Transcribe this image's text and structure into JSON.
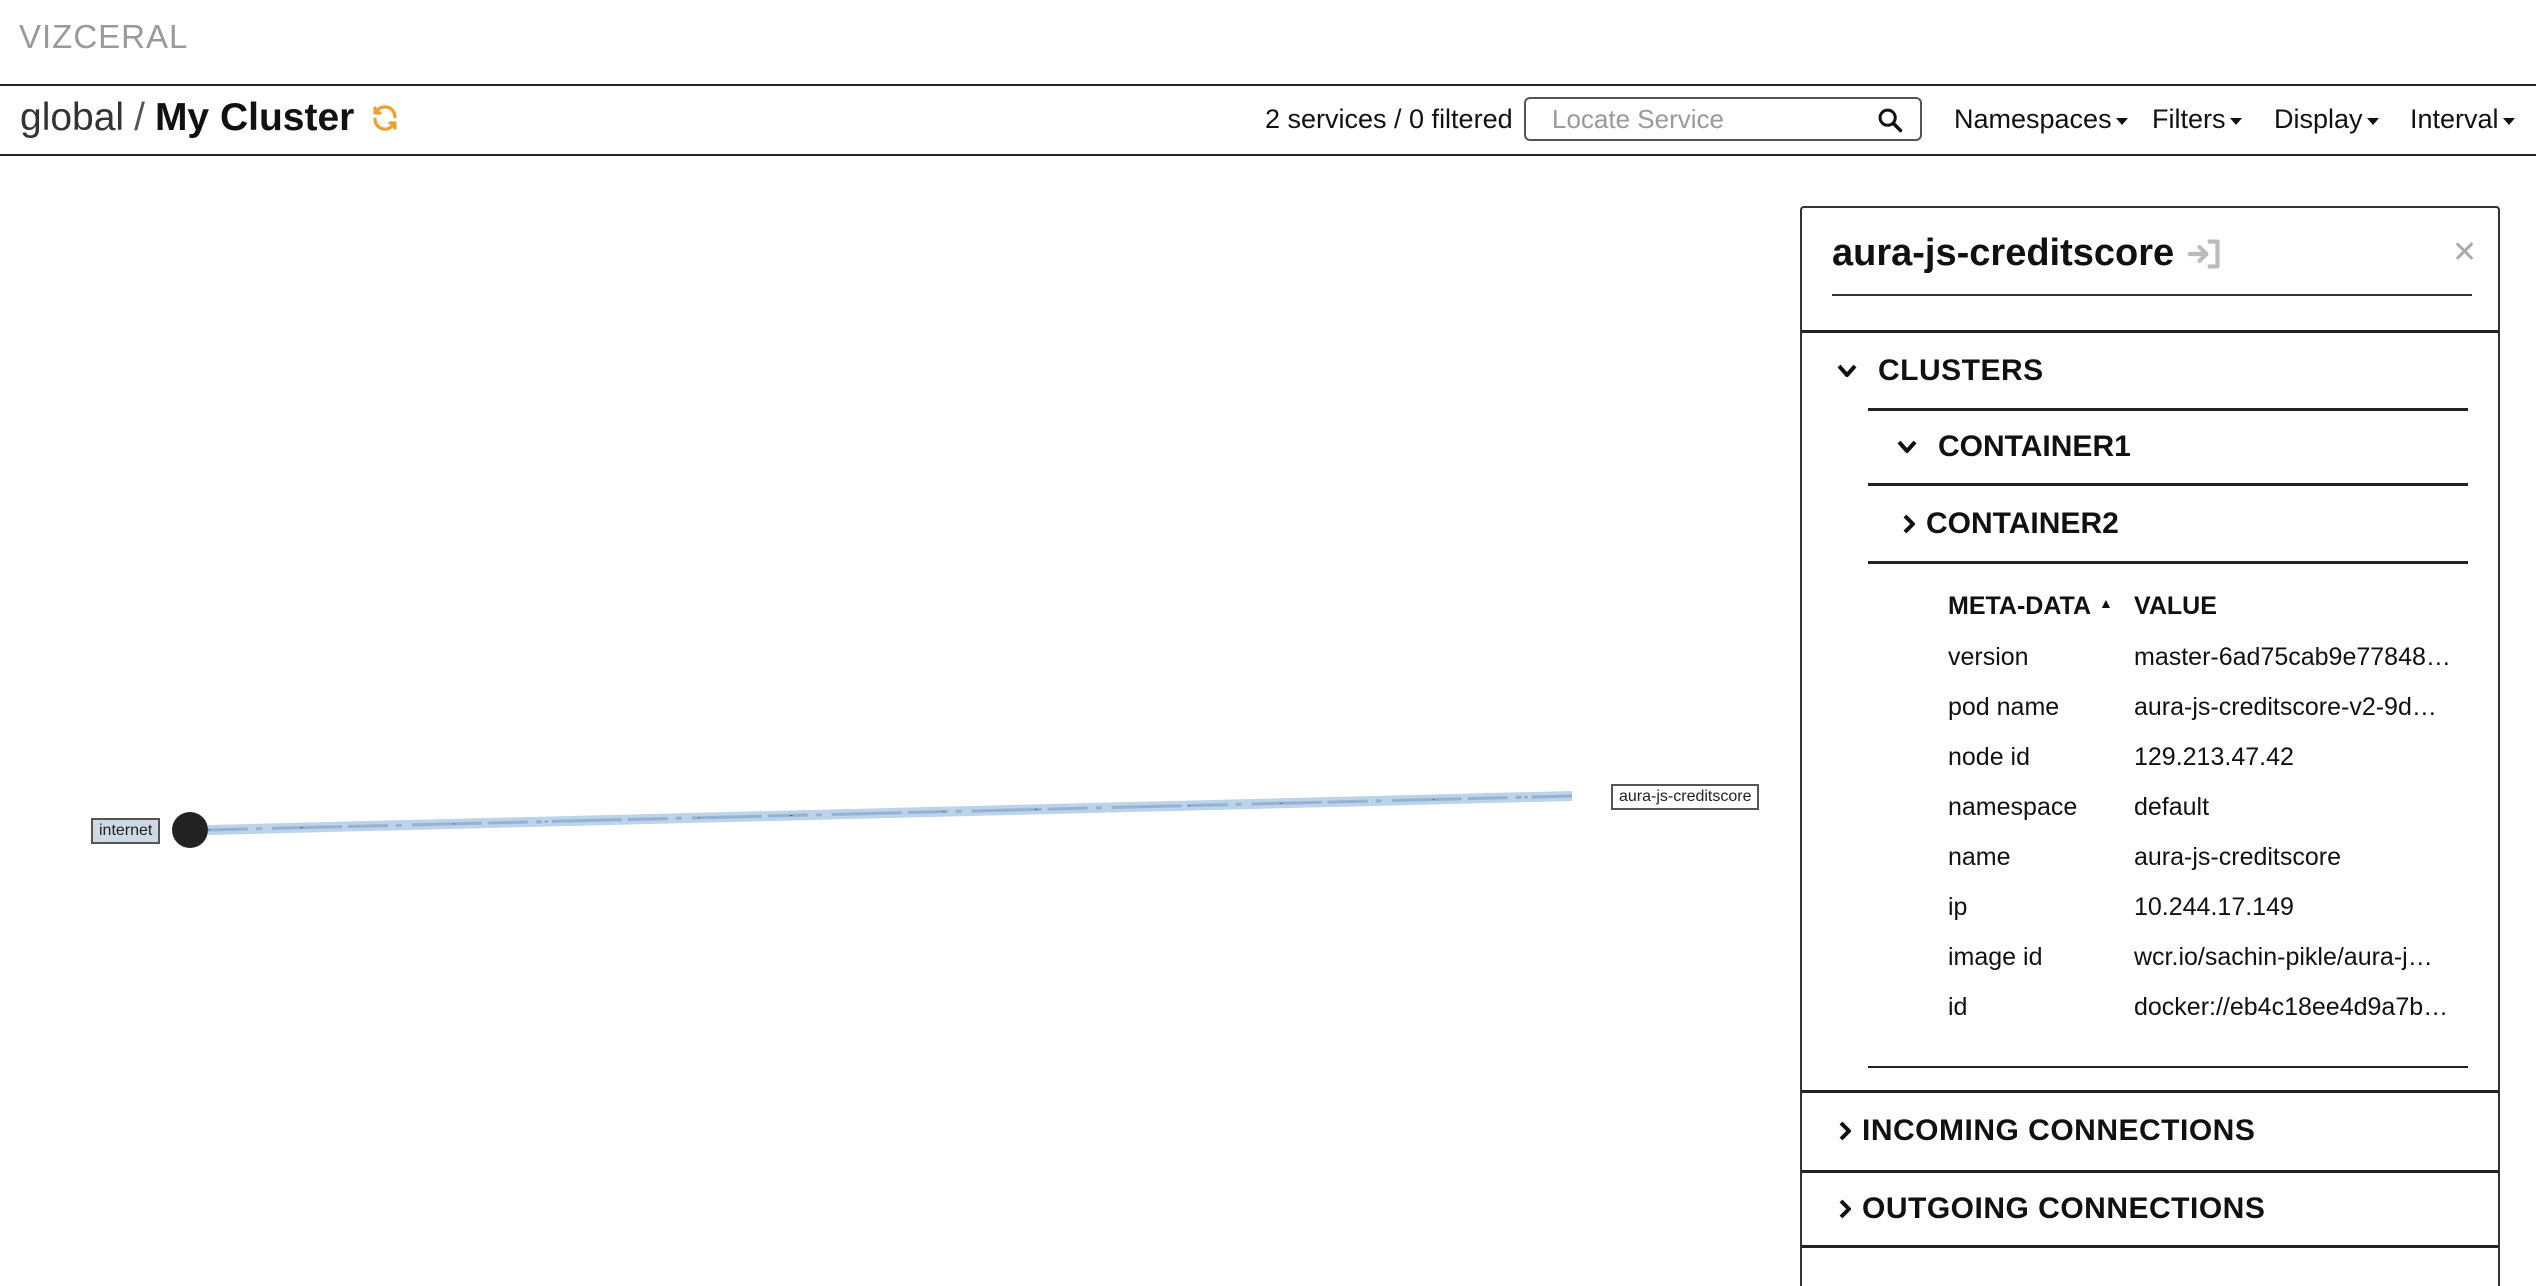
{
  "brand": "VIZCERAL",
  "breadcrumb": {
    "root": "global",
    "separator": "/",
    "current": "My Cluster"
  },
  "toolbar": {
    "service_count": "2 services / 0 filtered",
    "search_placeholder": "Locate Service",
    "menus": [
      "Namespaces",
      "Filters",
      "Display",
      "Interval"
    ]
  },
  "graph": {
    "nodes": [
      {
        "label": "internet"
      },
      {
        "label": "aura-js-creditscore"
      }
    ]
  },
  "panel": {
    "title": "aura-js-creditscore",
    "sections": {
      "clusters": "CLUSTERS",
      "container1": "CONTAINER1",
      "container2": "CONTAINER2",
      "incoming": "INCOMING CONNECTIONS",
      "outgoing": "OUTGOING CONNECTIONS"
    },
    "meta_headers": {
      "key": "META-DATA",
      "value": "VALUE"
    },
    "meta_rows": [
      {
        "key": "version",
        "value": "master-6ad75cab9e77848…"
      },
      {
        "key": "pod name",
        "value": "aura-js-creditscore-v2-9d…"
      },
      {
        "key": "node id",
        "value": "129.213.47.42"
      },
      {
        "key": "namespace",
        "value": "default"
      },
      {
        "key": "name",
        "value": "aura-js-creditscore"
      },
      {
        "key": "ip",
        "value": "10.244.17.149"
      },
      {
        "key": "image id",
        "value": "wcr.io/sachin-pikle/aura-j…"
      },
      {
        "key": "id",
        "value": "docker://eb4c18ee4d9a7b…"
      }
    ]
  },
  "colors": {
    "accent_refresh": "#f0a030",
    "traffic": "#a9c7e6",
    "node": "#222222"
  }
}
